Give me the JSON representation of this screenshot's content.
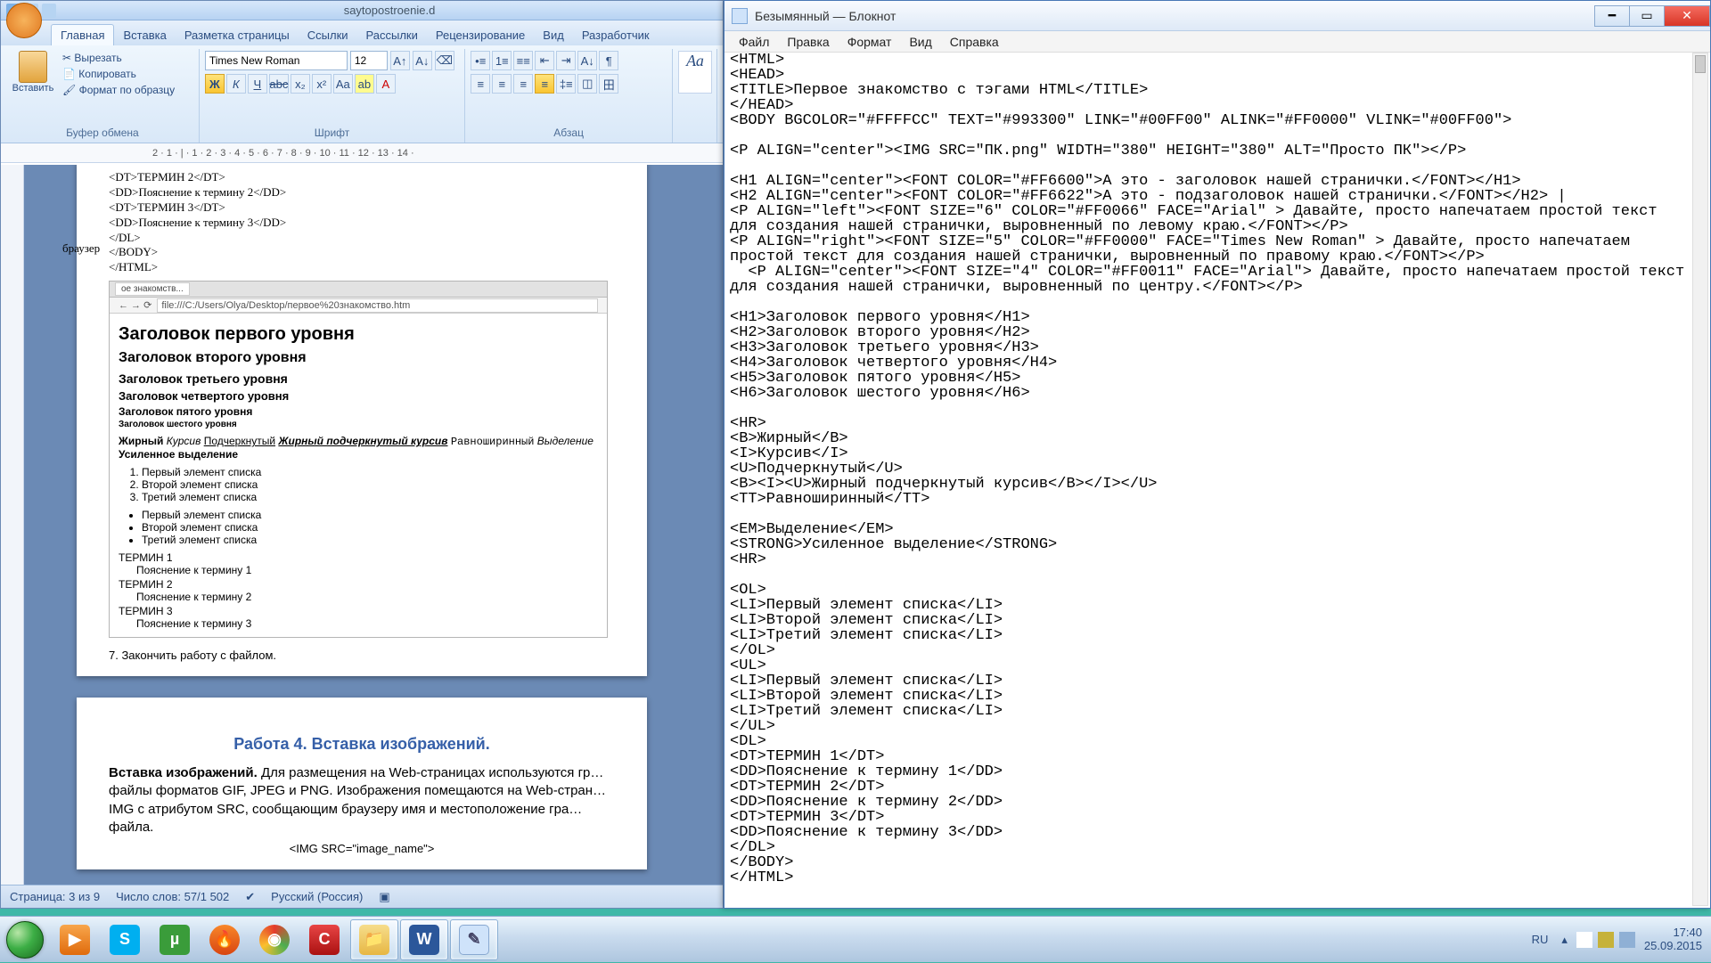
{
  "word": {
    "title": "saytopostroenie.d",
    "tabs": [
      "Главная",
      "Вставка",
      "Разметка страницы",
      "Ссылки",
      "Рассылки",
      "Рецензирование",
      "Вид",
      "Разработчик"
    ],
    "clipboard": {
      "paste": "Вставить",
      "cut": "Вырезать",
      "copy": "Копировать",
      "fmt": "Формат по образцу",
      "title": "Буфер обмена"
    },
    "font": {
      "name": "Times New Roman",
      "size": "12",
      "title": "Шрифт"
    },
    "paragraph_title": "Абзац",
    "styles_sample": "Аа",
    "ruler": "2 · 1 · | · 1 · 2 · 3 · 4 · 5 · 6 · 7 · 8 · 9 · 10 · 11 · 12 · 13 · 14 ·",
    "doc_top_code": "<DT>ТЕРМИН 2</DT>\n<DD>Пояснение к термину 2</DD>\n<DT>ТЕРМИН 3</DT>\n<DD>Пояснение к термину 3</DD>\n</DL>\n</BODY>\n</HTML>",
    "browser_label": "браузер",
    "browser_tab": "ое знакомств...",
    "browser_url": "file:///C:/Users/Olya/Desktop/первое%20знакомство.htm",
    "headings": {
      "h1": "Заголовок первого уровня",
      "h2": "Заголовок второго уровня",
      "h3": "Заголовок третьего уровня",
      "h4": "Заголовок четвертого уровня",
      "h5": "Заголовок пятого уровня",
      "h6": "Заголовок шестого уровня"
    },
    "fmt": {
      "bold": "Жирный",
      "italic": "Курсив",
      "under": "Подчеркнутый",
      "biu": "Жирный подчеркнутый курсив",
      "tt": "Равноширинный",
      "em": "Выделение",
      "strong": "Усиленное выделение"
    },
    "ol": [
      "Первый элемент списка",
      "Второй элемент списка",
      "Третий элемент списка"
    ],
    "ul": [
      "Первый элемент списка",
      "Второй элемент списка",
      "Третий элемент списка"
    ],
    "dl": [
      {
        "dt": "ТЕРМИН 1",
        "dd": "Пояснение к термину 1"
      },
      {
        "dt": "ТЕРМИН 2",
        "dd": "Пояснение к термину 2"
      },
      {
        "dt": "ТЕРМИН 3",
        "dd": "Пояснение к термину 3"
      }
    ],
    "finish_item": "7.   Закончить работу с файлом.",
    "work4": "Работа 4. Вставка изображений.",
    "insert_title": "Вставка изображений.",
    "insert_body": " Для размещения на Web-страницах используются гр… файлы форматов GIF, JPEG и PNG. Изображения помещаются на Web-стран… IMG с атрибутом SRC, сообщающим браузеру имя и местоположение гра… файла.",
    "imgsrc": "<IMG SRC=\"image_name\">",
    "status": {
      "page": "Страница: 3 из 9",
      "words": "Число слов: 57/1 502",
      "lang": "Русский (Россия)"
    }
  },
  "notepad": {
    "title": "Безымянный — Блокнот",
    "menus": [
      "Файл",
      "Правка",
      "Формат",
      "Вид",
      "Справка"
    ],
    "content": "<HTML>\n<HEAD>\n<TITLE>Первое знакомство с тэгами HTML</TITLE>\n</HEAD>\n<BODY BGCOLOR=\"#FFFFCC\" TEXT=\"#993300\" LINK=\"#00FF00\" ALINK=\"#FF0000\" VLINK=\"#00FF00\">\n\n<P ALIGN=\"center\"><IMG SRC=\"ПК.png\" WIDTH=\"380\" HEIGHT=\"380\" ALT=\"Просто ПК\"></P>\n\n<H1 ALIGN=\"center\"><FONT COLOR=\"#FF6600\">А это - заголовок нашей странички.</FONT></H1>\n<H2 ALIGN=\"center\"><FONT COLOR=\"#FF6622\">А это - подзаголовок нашей странички.</FONT></H2> |\n<P ALIGN=\"left\"><FONT SIZE=\"6\" COLOR=\"#FF0066\" FACE=\"Arial\" > Давайте, просто напечатаем простой текст для создания нашей странички, выровненный по левому краю.</FONT></P>\n<P ALIGN=\"right\"><FONT SIZE=\"5\" COLOR=\"#FF0000\" FACE=\"Times New Roman\" > Давайте, просто напечатаем простой текст для создания нашей странички, выровненный по правому краю.</FONT></P>\n  <P ALIGN=\"center\"><FONT SIZE=\"4\" COLOR=\"#FF0011\" FACE=\"Arial\"> Давайте, просто напечатаем простой текст для создания нашей странички, выровненный по центру.</FONT></P>\n\n<H1>Заголовок первого уровня</H1>\n<H2>Заголовок второго уровня</H2>\n<H3>Заголовок третьего уровня</H3>\n<H4>Заголовок четвертого уровня</H4>\n<H5>Заголовок пятого уровня</H5>\n<H6>Заголовок шестого уровня</H6>\n\n<HR>\n<B>Жирный</B>\n<I>Курсив</I>\n<U>Подчеркнутый</U>\n<B><I><U>Жирный подчеркнутый курсив</B></I></U>\n<TT>Равноширинный</TT>\n\n<EM>Выделение</EM>\n<STRONG>Усиленное выделение</STRONG>\n<HR>\n\n<OL>\n<LI>Первый элемент списка</LI>\n<LI>Второй элемент списка</LI>\n<LI>Третий элемент списка</LI>\n</OL>\n<UL>\n<LI>Первый элемент списка</LI>\n<LI>Второй элемент списка</LI>\n<LI>Третий элемент списка</LI>\n</UL>\n<DL>\n<DT>ТЕРМИН 1</DT>\n<DD>Пояснение к термину 1</DD>\n<DT>ТЕРМИН 2</DT>\n<DD>Пояснение к термину 2</DD>\n<DT>ТЕРМИН 3</DT>\n<DD>Пояснение к термину 3</DD>\n</DL>\n</BODY>\n</HTML>"
  },
  "taskbar": {
    "lang": "RU",
    "time": "17:40",
    "date": "25.09.2015"
  }
}
